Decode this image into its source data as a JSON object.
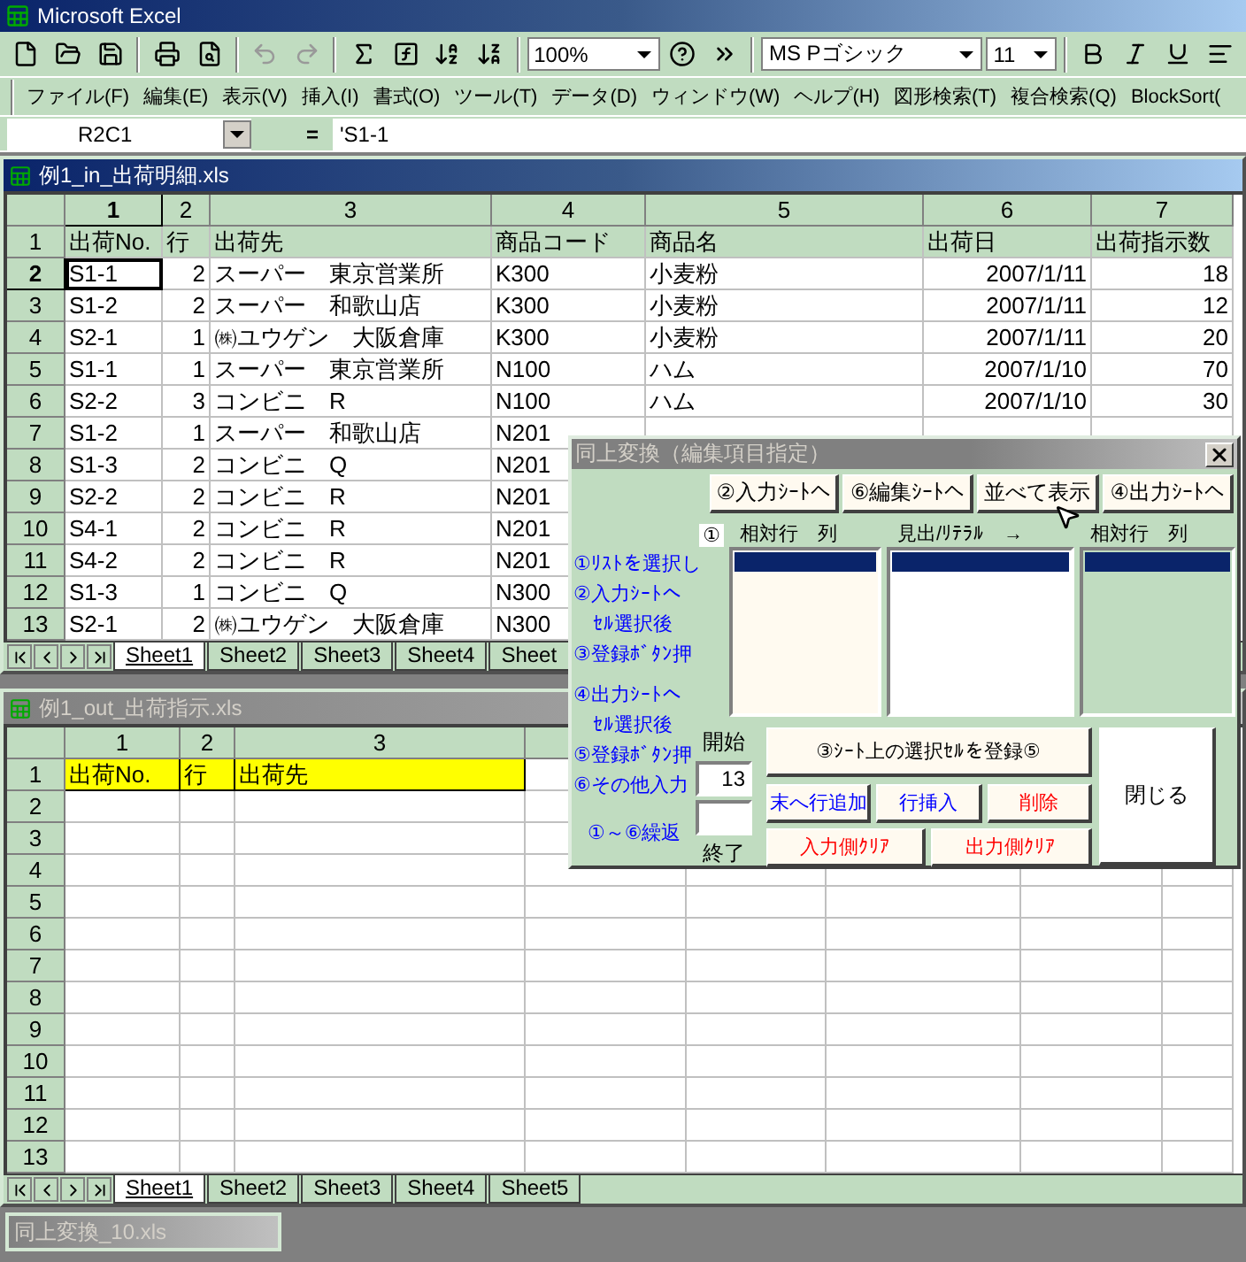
{
  "app_title": "Microsoft Excel",
  "toolbar": {
    "zoom": "100%",
    "font_name": "MS Pゴシック",
    "font_size": "11"
  },
  "menu": [
    "ファイル(F)",
    "編集(E)",
    "表示(V)",
    "挿入(I)",
    "書式(O)",
    "ツール(T)",
    "データ(D)",
    "ウィンドウ(W)",
    "ヘルプ(H)",
    "図形検索(T)",
    "複合検索(Q)",
    "BlockSort("
  ],
  "formula_bar": {
    "name_box": "R2C1",
    "equals": "=",
    "value": "'S1-1"
  },
  "workbooks": [
    {
      "title": "例1_in_出荷明細.xls",
      "active": true,
      "columns": [
        {
          "label": "1",
          "selected": true
        },
        {
          "label": "2",
          "selected": false
        },
        {
          "label": "3",
          "selected": false
        },
        {
          "label": "4",
          "selected": false
        },
        {
          "label": "5",
          "selected": false
        },
        {
          "label": "6",
          "selected": false
        },
        {
          "label": "7",
          "selected": false
        }
      ],
      "rows": [
        {
          "header": "1",
          "selected": false,
          "highlighted": false,
          "cells": [
            "出荷No.",
            "行",
            "出荷先",
            "商品コード",
            "商品名",
            "出荷日",
            "出荷指示数"
          ]
        },
        {
          "header": "2",
          "selected": true,
          "highlighted": false,
          "cells": [
            "S1-1",
            "2",
            "スーパー　東京営業所",
            "K300",
            "小麦粉",
            "2007/1/11",
            "18"
          ]
        },
        {
          "header": "3",
          "selected": false,
          "highlighted": false,
          "cells": [
            "S1-2",
            "2",
            "スーパー　和歌山店",
            "K300",
            "小麦粉",
            "2007/1/11",
            "12"
          ]
        },
        {
          "header": "4",
          "selected": false,
          "highlighted": false,
          "cells": [
            "S2-1",
            "1",
            "㈱ユウゲン　大阪倉庫",
            "K300",
            "小麦粉",
            "2007/1/11",
            "20"
          ]
        },
        {
          "header": "5",
          "selected": false,
          "highlighted": false,
          "cells": [
            "S1-1",
            "1",
            "スーパー　東京営業所",
            "N100",
            "ハム",
            "2007/1/10",
            "70"
          ]
        },
        {
          "header": "6",
          "selected": false,
          "highlighted": false,
          "cells": [
            "S2-2",
            "3",
            "コンビニ　R",
            "N100",
            "ハム",
            "2007/1/10",
            "30"
          ]
        },
        {
          "header": "7",
          "selected": false,
          "highlighted": false,
          "cells": [
            "S1-2",
            "1",
            "スーパー　和歌山店",
            "N201"
          ]
        },
        {
          "header": "8",
          "selected": false,
          "highlighted": false,
          "cells": [
            "S1-3",
            "2",
            "コンビニ　Q",
            "N201"
          ]
        },
        {
          "header": "9",
          "selected": false,
          "highlighted": false,
          "cells": [
            "S2-2",
            "2",
            "コンビニ　R",
            "N201"
          ]
        },
        {
          "header": "10",
          "selected": false,
          "highlighted": false,
          "cells": [
            "S4-1",
            "2",
            "コンビニ　R",
            "N201"
          ]
        },
        {
          "header": "11",
          "selected": false,
          "highlighted": false,
          "cells": [
            "S4-2",
            "2",
            "コンビニ　R",
            "N201"
          ]
        },
        {
          "header": "12",
          "selected": false,
          "highlighted": false,
          "cells": [
            "S1-3",
            "1",
            "コンビニ　Q",
            "N300"
          ]
        },
        {
          "header": "13",
          "selected": false,
          "highlighted": false,
          "cells": [
            "S2-1",
            "2",
            "㈱ユウゲン　大阪倉庫",
            "N300"
          ]
        }
      ],
      "sheet_tabs": [
        {
          "label": "Sheet1",
          "selected": true
        },
        {
          "label": "Sheet2",
          "selected": false
        },
        {
          "label": "Sheet3",
          "selected": false
        },
        {
          "label": "Sheet4",
          "selected": false
        },
        {
          "label": "Sheet",
          "selected": false
        }
      ]
    },
    {
      "title": "例1_out_出荷指示.xls",
      "active": false,
      "columns": [
        {
          "label": "1",
          "selected": false
        },
        {
          "label": "2",
          "selected": false
        },
        {
          "label": "3",
          "selected": false
        }
      ],
      "rows": [
        {
          "header": "1",
          "selected": false,
          "highlighted": true,
          "cells": [
            "出荷No.",
            "行",
            "出荷先"
          ]
        },
        {
          "header": "2",
          "selected": false,
          "highlighted": false,
          "cells": []
        },
        {
          "header": "3",
          "selected": false,
          "highlighted": false,
          "cells": []
        },
        {
          "header": "4",
          "selected": false,
          "highlighted": false,
          "cells": []
        },
        {
          "header": "5",
          "selected": false,
          "highlighted": false,
          "cells": []
        },
        {
          "header": "6",
          "selected": false,
          "highlighted": false,
          "cells": []
        },
        {
          "header": "7",
          "selected": false,
          "highlighted": false,
          "cells": []
        },
        {
          "header": "8",
          "selected": false,
          "highlighted": false,
          "cells": []
        },
        {
          "header": "9",
          "selected": false,
          "highlighted": false,
          "cells": []
        },
        {
          "header": "10",
          "selected": false,
          "highlighted": false,
          "cells": []
        },
        {
          "header": "11",
          "selected": false,
          "highlighted": false,
          "cells": []
        },
        {
          "header": "12",
          "selected": false,
          "highlighted": false,
          "cells": []
        },
        {
          "header": "13",
          "selected": false,
          "highlighted": false,
          "cells": []
        }
      ],
      "sheet_tabs": [
        {
          "label": "Sheet1",
          "selected": true
        },
        {
          "label": "Sheet2",
          "selected": false
        },
        {
          "label": "Sheet3",
          "selected": false
        },
        {
          "label": "Sheet4",
          "selected": false
        },
        {
          "label": "Sheet5",
          "selected": false
        }
      ]
    }
  ],
  "minimized_window": "同上変換_10.xls",
  "dialog": {
    "title": "同上変換（編集項目指定）",
    "nav_buttons": [
      "②入力ｼｰﾄへ",
      "⑥編集ｼｰﾄへ",
      "並べて表示",
      "④出力ｼｰﾄへ"
    ],
    "list_marker": "①",
    "lists": [
      {
        "header": "相対行　列",
        "selected_row": true
      },
      {
        "header": "見出/ﾘﾃﾗﾙ　→",
        "selected_row": true
      },
      {
        "header": "相対行　列",
        "selected_row": true
      }
    ],
    "instructions": [
      "①ﾘｽﾄを選択し",
      "②入力ｼｰﾄへ",
      "　ｾﾙ選択後",
      "③登録ﾎﾞﾀﾝ押",
      "④出力ｼｰﾄへ",
      "　ｾﾙ選択後",
      "⑤登録ﾎﾞﾀﾝ押",
      "⑥その他入力",
      "①～⑥繰返"
    ],
    "start_label": "開始",
    "start_value": "13",
    "end_label": "終了",
    "register_button": "③ｼｰﾄ上の選択ｾﾙを登録⑤",
    "action_buttons": [
      {
        "label": "末へ行追加",
        "color": "#0000ff"
      },
      {
        "label": "行挿入",
        "color": "#0000ff"
      },
      {
        "label": "削除",
        "color": "#ff0000"
      },
      {
        "label": "入力側ｸﾘｱ",
        "color": "#ff0000"
      },
      {
        "label": "出力側ｸﾘｱ",
        "color": "#ff0000"
      }
    ],
    "close_button": "閉じる"
  }
}
